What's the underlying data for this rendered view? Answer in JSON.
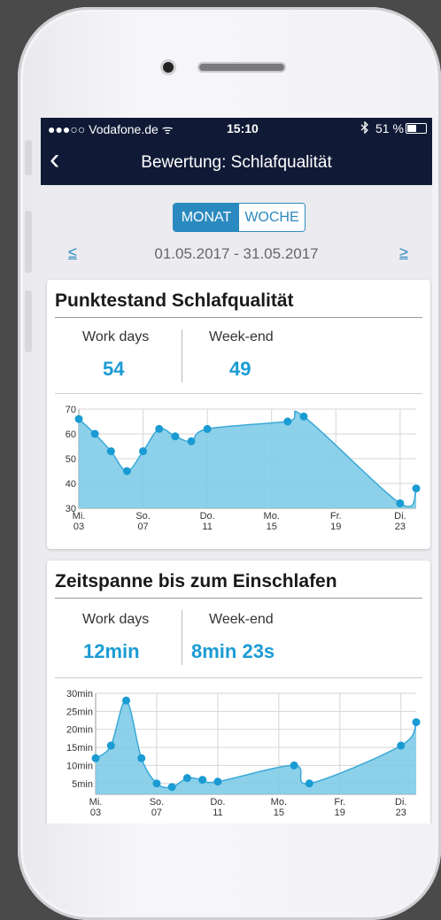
{
  "status": {
    "carrier": "●●●○○ Vodafone.de ᯤ",
    "time": "15:10",
    "battery": "51 %",
    "battery_level": 0.51
  },
  "nav": {
    "back": "‹",
    "back_icon": "chevron-left-icon",
    "title": "Bewertung: Schlafqualität"
  },
  "segment": {
    "options": [
      "MONAT",
      "WOCHE"
    ],
    "selected": "MONAT"
  },
  "period": {
    "prev": "≤",
    "next": "≥",
    "range": "01.05.2017 - 31.05.2017"
  },
  "colors": {
    "accent": "#1b9bd3",
    "nav_bg": "#101a36",
    "area_fill": "#7fcbe7",
    "point": "#1b9bd3"
  },
  "cards": [
    {
      "title": "Punktestand Schlafqualität",
      "workdays_label": "Work days",
      "weekend_label": "Week-end",
      "workdays_value": "54",
      "weekend_value": "49"
    },
    {
      "title": "Zeitspanne bis zum Einschlafen",
      "workdays_label": "Work days",
      "weekend_label": "Week-end",
      "workdays_value": "12min",
      "weekend_value": "8min 23s"
    }
  ],
  "chart_data": [
    {
      "type": "area",
      "title": "",
      "xlabel": "",
      "ylabel": "",
      "x_ticks": [
        {
          "day": 3,
          "label": [
            "Mi.",
            "03"
          ]
        },
        {
          "day": 7,
          "label": [
            "So.",
            "07"
          ]
        },
        {
          "day": 11,
          "label": [
            "Do.",
            "11"
          ]
        },
        {
          "day": 15,
          "label": [
            "Mo.",
            "15"
          ]
        },
        {
          "day": 19,
          "label": [
            "Fr.",
            "19"
          ]
        },
        {
          "day": 23,
          "label": [
            "Di.",
            "23"
          ]
        }
      ],
      "xlim": [
        3,
        24
      ],
      "y_ticks": [
        30,
        40,
        50,
        60,
        70
      ],
      "y_tick_labels": [
        "30",
        "40",
        "50",
        "60",
        "70"
      ],
      "ylim": [
        30,
        70
      ],
      "grid": true,
      "series": [
        {
          "x": [
            3,
            4,
            5,
            6,
            7,
            8,
            9,
            10,
            11,
            16,
            17,
            23,
            24
          ],
          "y": [
            66,
            60,
            53,
            45,
            53,
            62,
            59,
            57,
            62,
            65,
            67,
            32,
            38
          ]
        }
      ]
    },
    {
      "type": "area",
      "title": "",
      "xlabel": "",
      "ylabel": "",
      "x_ticks": [
        {
          "day": 3,
          "label": [
            "Mi.",
            "03"
          ]
        },
        {
          "day": 7,
          "label": [
            "So.",
            "07"
          ]
        },
        {
          "day": 11,
          "label": [
            "Do.",
            "11"
          ]
        },
        {
          "day": 15,
          "label": [
            "Mo.",
            "15"
          ]
        },
        {
          "day": 19,
          "label": [
            "Fr.",
            "19"
          ]
        },
        {
          "day": 23,
          "label": [
            "Di.",
            "23"
          ]
        }
      ],
      "xlim": [
        3,
        24
      ],
      "y_ticks": [
        5,
        10,
        15,
        20,
        25,
        30
      ],
      "y_tick_labels": [
        "5min",
        "10min",
        "15min",
        "20min",
        "25min",
        "30min"
      ],
      "ylim": [
        2,
        30
      ],
      "grid": true,
      "series": [
        {
          "x": [
            3,
            4,
            5,
            6,
            7,
            8,
            9,
            10,
            11,
            16,
            17,
            23,
            24
          ],
          "y": [
            12,
            15.5,
            28,
            12,
            5,
            4,
            6.5,
            6,
            5.5,
            10,
            5,
            15.5,
            22
          ]
        }
      ]
    }
  ]
}
